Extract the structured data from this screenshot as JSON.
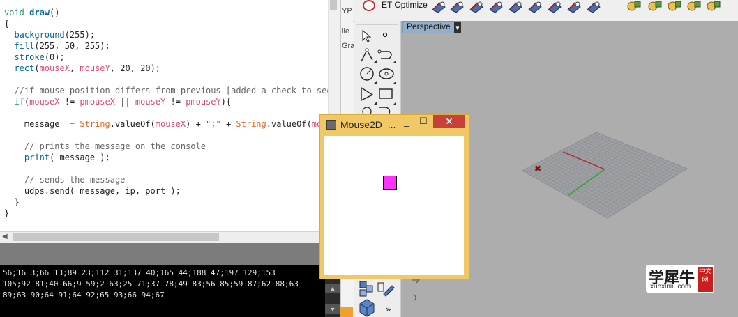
{
  "editor": {
    "code_lines": [
      [
        {
          "t": "void ",
          "c": "kw"
        },
        {
          "t": "draw",
          "c": "fnb"
        },
        {
          "t": "()",
          "c": ""
        }
      ],
      [
        {
          "t": "{",
          "c": ""
        }
      ],
      [
        {
          "t": "  ",
          "c": ""
        },
        {
          "t": "background",
          "c": "fn"
        },
        {
          "t": "(255);",
          "c": ""
        }
      ],
      [
        {
          "t": "  ",
          "c": ""
        },
        {
          "t": "fill",
          "c": "fn"
        },
        {
          "t": "(255, 50, 255);",
          "c": ""
        }
      ],
      [
        {
          "t": "  ",
          "c": ""
        },
        {
          "t": "stroke",
          "c": "fn"
        },
        {
          "t": "(0);",
          "c": ""
        }
      ],
      [
        {
          "t": "  ",
          "c": ""
        },
        {
          "t": "rect",
          "c": "fn"
        },
        {
          "t": "(",
          "c": ""
        },
        {
          "t": "mouseX",
          "c": "sy"
        },
        {
          "t": ", ",
          "c": ""
        },
        {
          "t": "mouseY",
          "c": "sy"
        },
        {
          "t": ", 20, 20);",
          "c": ""
        }
      ],
      [
        {
          "t": "",
          "c": ""
        }
      ],
      [
        {
          "t": "  //if mouse position differs from previous [added a check to see",
          "c": "cm"
        }
      ],
      [
        {
          "t": "  ",
          "c": ""
        },
        {
          "t": "if",
          "c": "kw"
        },
        {
          "t": "(",
          "c": ""
        },
        {
          "t": "mouseX",
          "c": "sy"
        },
        {
          "t": " != ",
          "c": ""
        },
        {
          "t": "pmouseX",
          "c": "sy"
        },
        {
          "t": " || ",
          "c": ""
        },
        {
          "t": "mouseY",
          "c": "sy"
        },
        {
          "t": " != ",
          "c": ""
        },
        {
          "t": "pmouseY",
          "c": "sy"
        },
        {
          "t": "){",
          "c": ""
        }
      ],
      [
        {
          "t": "",
          "c": ""
        }
      ],
      [
        {
          "t": "    message  = ",
          "c": ""
        },
        {
          "t": "String",
          "c": "ty"
        },
        {
          "t": ".valueOf(",
          "c": ""
        },
        {
          "t": "mouseX",
          "c": "sy"
        },
        {
          "t": ") + ",
          "c": ""
        },
        {
          "t": "\";\"",
          "c": "st"
        },
        {
          "t": " + ",
          "c": ""
        },
        {
          "t": "String",
          "c": "ty"
        },
        {
          "t": ".valueOf(",
          "c": ""
        },
        {
          "t": "mous",
          "c": "sy"
        }
      ],
      [
        {
          "t": "",
          "c": ""
        }
      ],
      [
        {
          "t": "    // prints the message on the console",
          "c": "cm"
        }
      ],
      [
        {
          "t": "    ",
          "c": ""
        },
        {
          "t": "print",
          "c": "fn"
        },
        {
          "t": "( message );",
          "c": ""
        }
      ],
      [
        {
          "t": "",
          "c": ""
        }
      ],
      [
        {
          "t": "    // sends the message",
          "c": "cm"
        }
      ],
      [
        {
          "t": "    udps.send( message, ip, port );",
          "c": ""
        }
      ],
      [
        {
          "t": "  }",
          "c": ""
        }
      ],
      [
        {
          "t": "}",
          "c": ""
        }
      ]
    ]
  },
  "console": {
    "lines": [
      "56;16 3;66 13;89 23;112 31;137 40;165 44;188 47;197 129;153",
      "105;92 81;40 66;9 59;2 63;25 71;37 78;49 83;56 85;59 87;62 88;63",
      "89;63 90;64 91;64 92;65 93;66 94;67"
    ]
  },
  "rhino": {
    "strip_labels": [
      "YP",
      "ile",
      "Gra"
    ],
    "toolbar_label": "ET Optimize",
    "viewport_tab": "Perspective",
    "more_tools": "»"
  },
  "sketch_window": {
    "title": "Mouse2D_...",
    "min_glyph": "_",
    "max_glyph": "☐",
    "close_glyph": "✕",
    "canvas_background": "#ffffff",
    "rect_fill": "#ff32ff"
  },
  "watermark": {
    "main": "学犀牛",
    "url": "xuexiniu.com",
    "badge": "中文网"
  }
}
